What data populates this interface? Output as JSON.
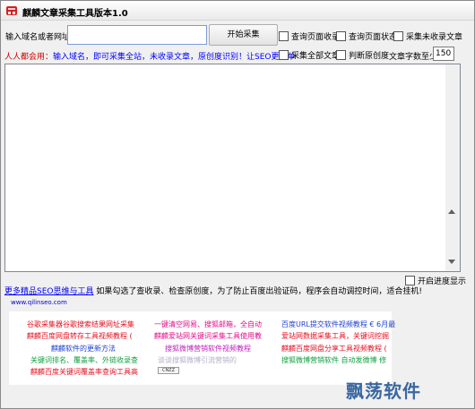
{
  "window": {
    "title": "麒麟文章采集工具版本1.0"
  },
  "form": {
    "domain_label": "输入域名或者网址",
    "domain_value": "",
    "start_button": "开始采集",
    "checkboxes": [
      {
        "label": "查询页面收录",
        "checked": false
      },
      {
        "label": "查询页面状态",
        "checked": false
      },
      {
        "label": "采集未收录文章",
        "checked": false
      },
      {
        "label": "采集全部文章",
        "checked": false
      },
      {
        "label": "判断原创度",
        "checked": false
      }
    ],
    "tip": "人人都会用：输入域名，即可采集全站，未收录文章，原创度识别！让SEO更简单",
    "word_count_label": "文章字数至少",
    "word_count_value": "150"
  },
  "results": {
    "rows": []
  },
  "progress_checkbox": {
    "label": "开启进度显示",
    "checked": false
  },
  "status": {
    "link_text": "更多精品SEO思维与工具",
    "message": "如果勾选了查收录、检查原创度，为了防止百度出验证码，程序会自动调控时间，适合挂机!"
  },
  "site_url": "www.qilinseo.com",
  "ads": [
    {
      "text": "谷歌采集器谷歌搜索结果网址采集",
      "color": "#e01020"
    },
    {
      "text": "一键清空网易、搜狐邮箱，全自动",
      "color": "#e0108a"
    },
    {
      "text": "百度URL提交软件视频教程 € 6月最",
      "color": "#2040d0"
    },
    {
      "text": "麒麟百度网盘转存工具视频教程 (",
      "color": "#e01020"
    },
    {
      "text": "麒麟爱站网关键词采集工具使用教",
      "color": "#e0108a"
    },
    {
      "text": "爱站网数据采集工具，关键词挖掘",
      "color": "#e01020"
    },
    {
      "text": "麒麟软件的更新方法",
      "color": "#2040d0"
    },
    {
      "text": "搜狐微博营销软件视频教程",
      "color": "#c020c0"
    },
    {
      "text": "麒麟百度网盘分享工具视频教程 (",
      "color": "#e01020"
    },
    {
      "text": "关键词排名、覆盖率、外链收录查",
      "color": "#10a040"
    },
    {
      "text": "搜狐微博营销软件   自动发微博  修",
      "color": "#10a040"
    },
    {
      "text": "麒麟百度关键词覆盖率查询工具高",
      "color": "#e01020"
    },
    {
      "text": "谈谈搜狐微博引流营销的",
      "color": "#b0b0c8"
    }
  ],
  "cnzz_badge": "CNZZ",
  "watermark": "飘荡软件"
}
